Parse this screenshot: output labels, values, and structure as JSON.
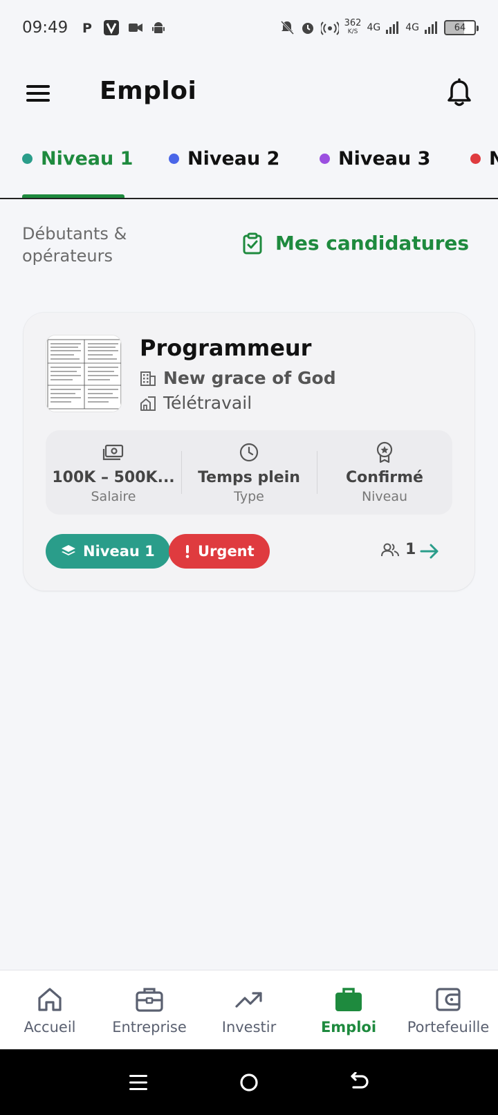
{
  "status_bar": {
    "time": "09:49",
    "net_speed": "362",
    "net_unit": "K/S",
    "network_1": "4G",
    "network_2": "4G",
    "battery": "64",
    "icons": [
      "parking-icon",
      "v-app-icon",
      "video-camera-icon",
      "android-icon",
      "bell-off-icon",
      "alarm-icon",
      "hotspot-icon",
      "signal-icon",
      "battery-icon"
    ]
  },
  "header": {
    "title": "Emploi",
    "menu_icon": "menu-icon",
    "notification_icon": "bell-icon"
  },
  "tabs": [
    {
      "label": "Niveau 1",
      "color": "#2a9d8a",
      "active": true
    },
    {
      "label": "Niveau 2",
      "color": "#4a66e8",
      "active": false
    },
    {
      "label": "Niveau 3",
      "color": "#9b4fe0",
      "active": false
    },
    {
      "label": "N",
      "color": "#df3b3f",
      "active": false
    }
  ],
  "subheader": {
    "description": "Débutants & opérateurs",
    "my_applications_label": "Mes candidatures"
  },
  "job": {
    "title": "Programmeur",
    "company": "New grace of God",
    "work_mode": "Télétravail",
    "salary_value": "100K – 500K...",
    "salary_label": "Salaire",
    "type_value": "Temps plein",
    "type_label": "Type",
    "level_value": "Confirmé",
    "level_label": "Niveau",
    "level_badge": "Niveau 1",
    "urgent_badge": "Urgent",
    "applicants_count": "1"
  },
  "bottom_nav": [
    {
      "label": "Accueil",
      "icon": "home-icon",
      "active": false
    },
    {
      "label": "Entreprise",
      "icon": "briefcase-outline-icon",
      "active": false
    },
    {
      "label": "Investir",
      "icon": "trending-up-icon",
      "active": false
    },
    {
      "label": "Emploi",
      "icon": "briefcase-filled-icon",
      "active": true
    },
    {
      "label": "Portefeuille",
      "icon": "wallet-icon",
      "active": false
    }
  ],
  "colors": {
    "accent_green": "#1e8a3e",
    "teal": "#2a9d8a",
    "urgent_red": "#df3b3f"
  }
}
